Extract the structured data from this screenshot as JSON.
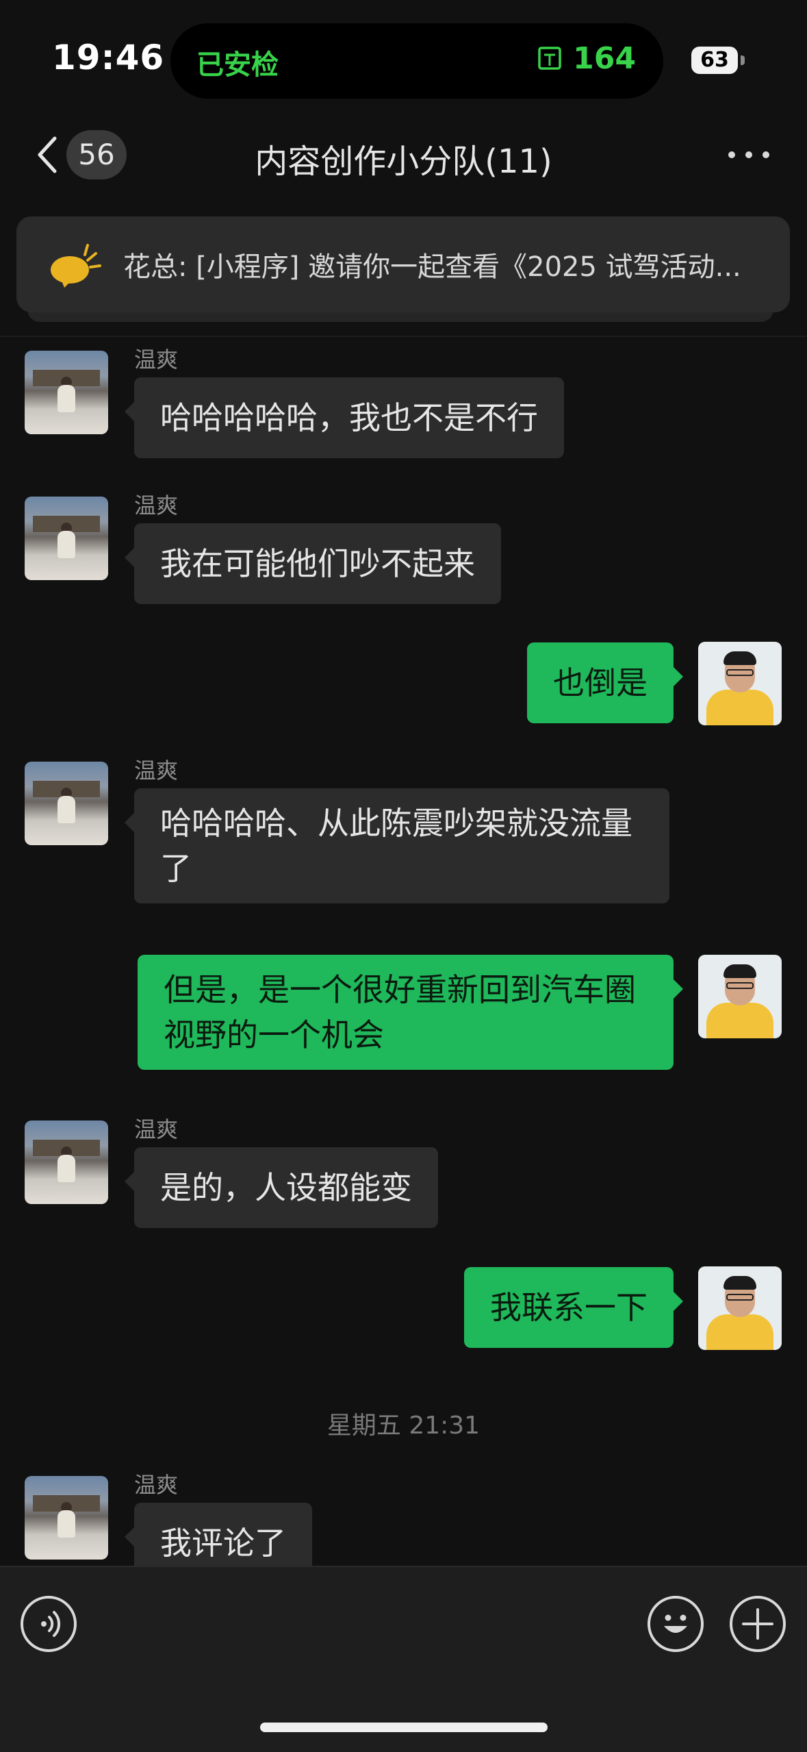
{
  "status_bar": {
    "time": "19:46",
    "island_left": "已安检",
    "island_right": "164",
    "battery": "63"
  },
  "nav": {
    "unread_count": "56",
    "title": "内容创作小分队(11)"
  },
  "pinned": {
    "text": "花总: [小程序] 邀请你一起查看《2025 试驾活动..."
  },
  "messages": [
    {
      "sender": "温爽",
      "text": "哈哈哈哈哈，我也不是不行"
    },
    {
      "sender": "温爽",
      "text": "我在可能他们吵不起来"
    },
    {
      "text": "也倒是"
    },
    {
      "sender": "温爽",
      "text": "哈哈哈哈、从此陈震吵架就没流量了"
    },
    {
      "text": "但是，是一个很好重新回到汽车圈视野的一个机会"
    },
    {
      "sender": "温爽",
      "text": "是的，人设都能变"
    },
    {
      "text": "我联系一下"
    },
    {
      "sender": "温爽",
      "text": "我评论了"
    }
  ],
  "timestamp": "星期五 21:31",
  "colors": {
    "accent_green": "#1fb85a",
    "island_green": "#38d34a",
    "background": "#111111"
  },
  "icons": [
    "chevron-left-icon",
    "more-dots-icon",
    "megaphone-icon",
    "voice-icon",
    "emoji-icon",
    "plus-icon"
  ]
}
